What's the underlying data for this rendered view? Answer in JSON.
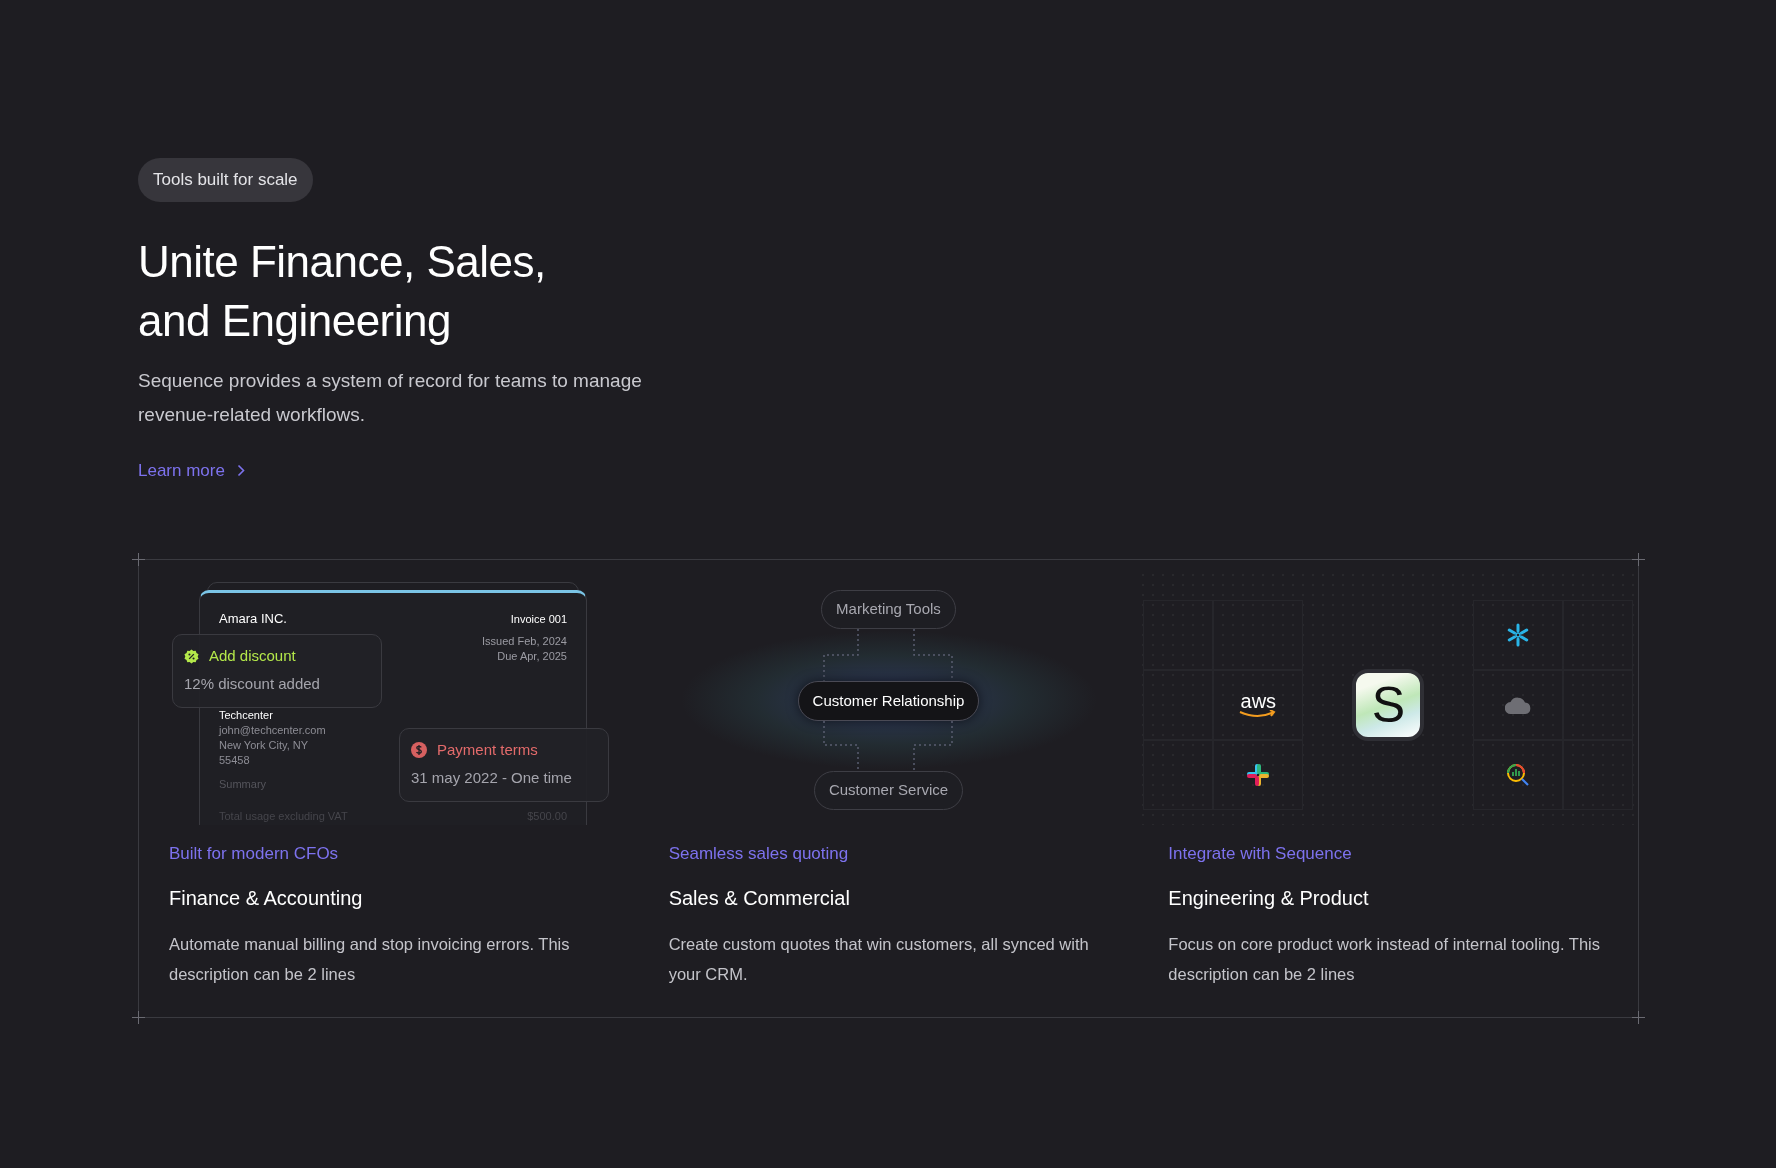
{
  "badge": "Tools built for scale",
  "heading_lines": [
    "Unite Finance, Sales,",
    "and Engineering"
  ],
  "description": "Sequence provides a system of record for teams to manage revenue-related workflows.",
  "link": {
    "label": "Learn more"
  },
  "cards": [
    {
      "kind": "invoice",
      "subtitle": "Built for modern CFOs",
      "title": "Finance & Accounting",
      "description": "Automate manual billing and stop invoicing errors. This description can be 2 lines",
      "invoice": {
        "company": "Amara INC.",
        "number": "Invoice 001",
        "issued": "Issued Feb, 2024",
        "due": "Due Apr, 2025",
        "customer": "Techcenter",
        "customer_lines": [
          "john@techcenter.com",
          "New York City, NY",
          "55458"
        ],
        "summary": "Summary",
        "total_label": "Total usage excluding VAT",
        "total_value": "$500.00"
      },
      "popups": [
        {
          "kind": "discount",
          "title": "Add discount",
          "detail": "12% discount added"
        },
        {
          "kind": "payment",
          "title": "Payment terms",
          "detail": "31 may 2022 - One time"
        }
      ]
    },
    {
      "kind": "crm",
      "subtitle": "Seamless sales quoting",
      "title": "Sales & Commercial",
      "description": "Create custom quotes that win customers, all synced with your CRM.",
      "nodes": [
        {
          "label": "Marketing Tools",
          "selected": false
        },
        {
          "label": "Customer Relationship",
          "selected": true
        },
        {
          "label": "Customer Service",
          "selected": false
        }
      ]
    },
    {
      "kind": "integrations",
      "subtitle": "Integrate with Sequence",
      "title": "Engineering & Product",
      "description": "Focus on core product work instead of internal tooling. This description can be 2 lines",
      "logo_text": "S",
      "aws_text": "aws"
    }
  ]
}
